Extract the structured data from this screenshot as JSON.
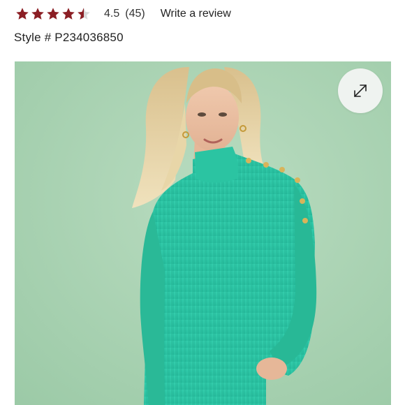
{
  "rating": {
    "stars": 4.5,
    "value_text": "4.5",
    "count_text": "(45)",
    "star_color": "#8b1e24",
    "star_empty_color": "#d9d9d9"
  },
  "review": {
    "write_label": "Write a review"
  },
  "product": {
    "style_text": "Style # P234036850"
  },
  "image": {
    "background_color": "#a8d3b1",
    "sweater_color": "#2fc7a6",
    "expand_icon": "expand-arrows-icon"
  }
}
